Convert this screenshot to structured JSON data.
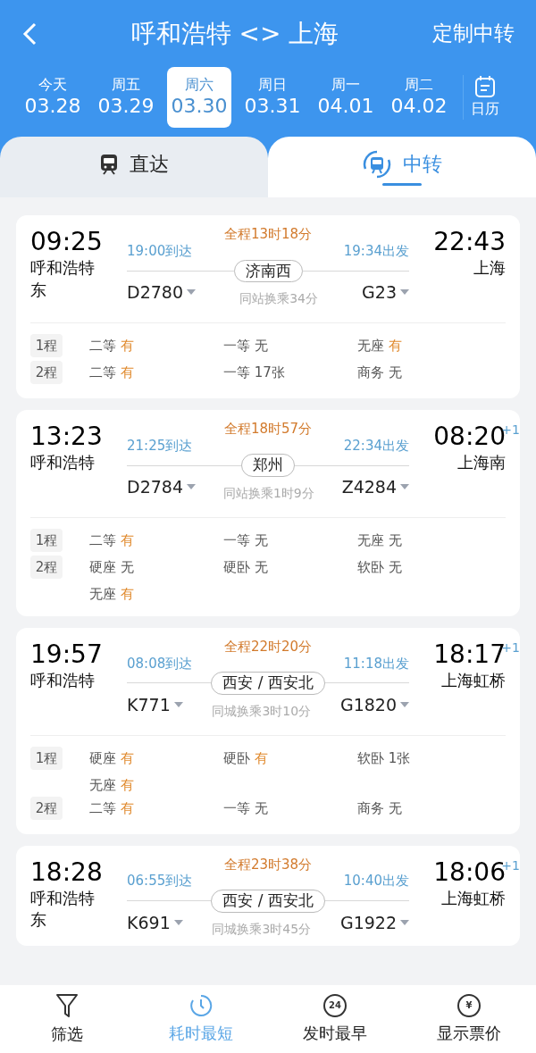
{
  "header": {
    "title": "呼和浩特 <> 上海",
    "action": "定制中转"
  },
  "dates": [
    {
      "day": "今天",
      "date": "03.28",
      "selected": false
    },
    {
      "day": "周五",
      "date": "03.29",
      "selected": false
    },
    {
      "day": "周六",
      "date": "03.30",
      "selected": true
    },
    {
      "day": "周日",
      "date": "03.31",
      "selected": false
    },
    {
      "day": "周一",
      "date": "04.01",
      "selected": false
    },
    {
      "day": "周二",
      "date": "04.02",
      "selected": false
    }
  ],
  "calendar": {
    "label": "日历"
  },
  "tabs": [
    {
      "kind": "direct",
      "label": "直达",
      "selected": false
    },
    {
      "kind": "transfer",
      "label": "中转",
      "selected": true
    }
  ],
  "results": [
    {
      "depart_time": "09:25",
      "from_station": "呼和浩特东",
      "arrive_leg1": "19:00到达",
      "train1": "D2780",
      "duration": "全程13时18分",
      "transfer_station": "济南西",
      "transfer_note": "同站换乘34分",
      "depart_leg2": "19:34出发",
      "train2": "G23",
      "arrive_time": "22:43",
      "to_station": "上海",
      "legs": [
        {
          "label": "1程",
          "seats": [
            {
              "class": "二等",
              "status": "有",
              "available": true
            },
            {
              "class": "一等",
              "status": "无",
              "available": false
            },
            {
              "class": "无座",
              "status": "有",
              "available": true
            }
          ]
        },
        {
          "label": "2程",
          "seats": [
            {
              "class": "二等",
              "status": "有",
              "available": true
            },
            {
              "class": "一等",
              "status": "17张",
              "available": false
            },
            {
              "class": "商务",
              "status": "无",
              "available": false
            }
          ]
        }
      ]
    },
    {
      "depart_time": "13:23",
      "from_station": "呼和浩特",
      "arrive_leg1": "21:25到达",
      "train1": "D2784",
      "duration": "全程18时57分",
      "transfer_station": "郑州",
      "transfer_note": "同站换乘1时9分",
      "depart_leg2": "22:34出发",
      "train2": "Z4284",
      "arrive_time": "08:20",
      "next_day": "+1",
      "to_station": "上海南",
      "legs": [
        {
          "label": "1程",
          "seats": [
            {
              "class": "二等",
              "status": "有",
              "available": true
            },
            {
              "class": "一等",
              "status": "无",
              "available": false
            },
            {
              "class": "无座",
              "status": "无",
              "available": false
            }
          ]
        },
        {
          "label": "2程",
          "seats": [
            {
              "class": "硬座",
              "status": "无",
              "available": false
            },
            {
              "class": "硬卧",
              "status": "无",
              "available": false
            },
            {
              "class": "软卧",
              "status": "无",
              "available": false
            },
            {
              "class": "无座",
              "status": "有",
              "available": true
            }
          ]
        }
      ]
    },
    {
      "depart_time": "19:57",
      "from_station": "呼和浩特",
      "arrive_leg1": "08:08到达",
      "train1": "K771",
      "duration": "全程22时20分",
      "transfer_station": "西安 / 西安北",
      "transfer_note": "同城换乘3时10分",
      "depart_leg2": "11:18出发",
      "train2": "G1820",
      "arrive_time": "18:17",
      "next_day": "+1",
      "to_station": "上海虹桥",
      "legs": [
        {
          "label": "1程",
          "seats": [
            {
              "class": "硬座",
              "status": "有",
              "available": true
            },
            {
              "class": "硬卧",
              "status": "有",
              "available": true
            },
            {
              "class": "软卧",
              "status": "1张",
              "available": false
            },
            {
              "class": "无座",
              "status": "有",
              "available": true
            }
          ]
        },
        {
          "label": "2程",
          "seats": [
            {
              "class": "二等",
              "status": "有",
              "available": true
            },
            {
              "class": "一等",
              "status": "无",
              "available": false
            },
            {
              "class": "商务",
              "status": "无",
              "available": false
            }
          ]
        }
      ]
    },
    {
      "depart_time": "18:28",
      "from_station": "呼和浩特东",
      "arrive_leg1": "06:55到达",
      "train1": "K691",
      "duration": "全程23时38分",
      "transfer_station": "西安 / 西安北",
      "transfer_note": "同城换乘3时45分",
      "depart_leg2": "10:40出发",
      "train2": "G1922",
      "arrive_time": "18:06",
      "next_day": "+1",
      "to_station": "上海虹桥"
    }
  ],
  "bottom_bar": [
    {
      "kind": "filter",
      "label": "筛选",
      "selected": false
    },
    {
      "kind": "clock",
      "label": "耗时最短",
      "selected": true
    },
    {
      "kind": "circle-text",
      "icon_text": "24",
      "label": "发时最早",
      "selected": false
    },
    {
      "kind": "circle-text",
      "icon_text": "¥",
      "label": "显示票价",
      "selected": false
    }
  ]
}
